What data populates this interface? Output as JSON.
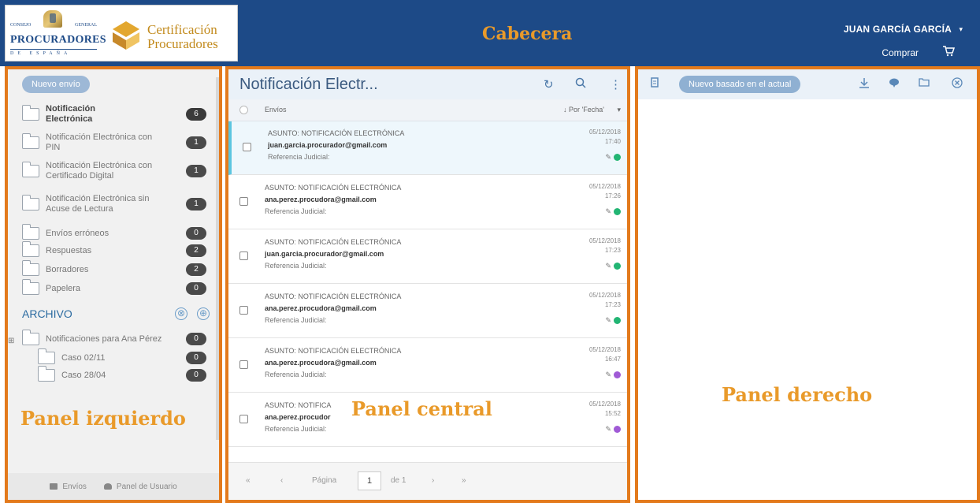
{
  "header": {
    "label": "Cabecera",
    "logo": {
      "consejo_left": "CONSEJO",
      "consejo_right": "GENERAL",
      "name": "PROCURADORES",
      "country": "DE ESPAÑA"
    },
    "cert_line1": "Certificación",
    "cert_line2": "Procuradores",
    "user_name": "JUAN GARCÍA GARCÍA",
    "user_caret": "▾",
    "buy_label": "Comprar",
    "brand_color": "#1d4a87",
    "accent_color": "#e37a1c"
  },
  "left_panel": {
    "label": "Panel izquierdo",
    "new_button": "Nuevo envío",
    "folders": [
      {
        "line1": "Notificación",
        "line2": "Electrónica",
        "count": "6"
      },
      {
        "line1": "Notificación Electrónica con",
        "line2": "PIN",
        "count": "1"
      },
      {
        "line1": "Notificación Electrónica con",
        "line2": "Certificado Digital",
        "count": "1"
      },
      {
        "line1": "Notificación Electrónica sin",
        "line2": "Acuse de Lectura",
        "count": "1"
      },
      {
        "line1": "Envíos erróneos",
        "line2": "",
        "count": "0"
      },
      {
        "line1": "Respuestas",
        "line2": "",
        "count": "2"
      },
      {
        "line1": "Borradores",
        "line2": "",
        "count": "2"
      },
      {
        "line1": "Papelera",
        "line2": "",
        "count": "0"
      }
    ],
    "archive_title": "ARCHIVO",
    "archive_remove_icon": "⊗",
    "archive_add_icon": "⊕",
    "expand_mark": "⊞",
    "archive_folders": [
      {
        "label": "Notificaciones para Ana Pérez",
        "count": "0"
      },
      {
        "label": "Caso 02/11",
        "count": "0"
      },
      {
        "label": "Caso 28/04",
        "count": "0"
      }
    ],
    "footer": {
      "envios": "Envíos",
      "panel_usuario": "Panel de Usuario"
    }
  },
  "center_panel": {
    "label": "Panel central",
    "title": "Notificación Electr...",
    "icons": {
      "refresh": "↻",
      "search": "🔍",
      "more": "⋮"
    },
    "column_name": "Envíos",
    "sort_label": "↓ Por 'Fecha'",
    "sort_caret": "▾",
    "messages": [
      {
        "subject": "ASUNTO: NOTIFICACIÓN ELECTRÓNICA",
        "email": "juan.garcia.procurador@gmail.com",
        "ref": "Referencia Judicial:",
        "date": "05/12/2018",
        "time": "17:40",
        "status_color": "#22b573",
        "selected": true
      },
      {
        "subject": "ASUNTO: NOTIFICACIÓN ELECTRÓNICA",
        "email": "ana.perez.procudora@gmail.com",
        "ref": "Referencia Judicial:",
        "date": "05/12/2018",
        "time": "17:26",
        "status_color": "#22b573"
      },
      {
        "subject": "ASUNTO: NOTIFICACIÓN ELECTRÓNICA",
        "email": "juan.garcia.procurador@gmail.com",
        "ref": "Referencia Judicial:",
        "date": "05/12/2018",
        "time": "17:23",
        "status_color": "#22b573"
      },
      {
        "subject": "ASUNTO: NOTIFICACIÓN ELECTRÓNICA",
        "email": "ana.perez.procudora@gmail.com",
        "ref": "Referencia Judicial:",
        "date": "05/12/2018",
        "time": "17:23",
        "status_color": "#22b573"
      },
      {
        "subject": "ASUNTO: NOTIFICACIÓN ELECTRÓNICA",
        "email": "ana.perez.procudora@gmail.com",
        "ref": "Referencia Judicial:",
        "date": "05/12/2018",
        "time": "16:47",
        "status_color": "#a05ad6"
      },
      {
        "subject": "ASUNTO: NOTIFICA",
        "email": "ana.perez.procudor",
        "ref": "Referencia Judicial:",
        "date": "05/12/2018",
        "time": "15:52",
        "status_color": "#a05ad6"
      }
    ],
    "pager": {
      "first": "«",
      "prev": "‹",
      "page_label": "Página",
      "page_value": "1",
      "of_label": "de 1",
      "next": "›",
      "last": "»"
    }
  },
  "right_panel": {
    "label": "Panel derecho",
    "new_based_button": "Nuevo basado en el actual"
  }
}
